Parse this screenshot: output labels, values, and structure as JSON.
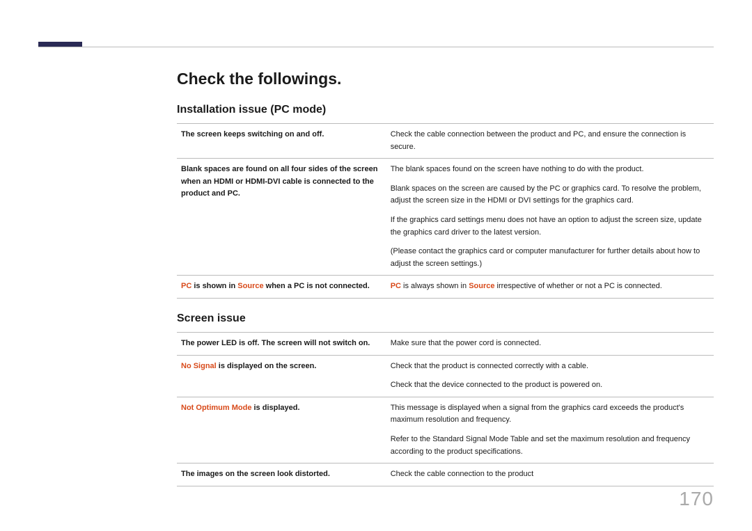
{
  "heading": "Check the followings.",
  "section1": {
    "title": "Installation issue (PC mode)",
    "rows": [
      {
        "problem_parts": [
          {
            "t": "The screen keeps switching on and off.",
            "c": ""
          }
        ],
        "solutions": [
          "Check the cable connection between the product and PC, and ensure the connection is secure."
        ]
      },
      {
        "problem_parts": [
          {
            "t": "Blank spaces are found on all four sides of the screen when an HDMI or HDMI-DVI cable is connected to the product and PC.",
            "c": ""
          }
        ],
        "solutions": [
          "The blank spaces found on the screen have nothing to do with the product.",
          "Blank spaces on the screen are caused by the PC or graphics card. To resolve the problem, adjust the screen size in the HDMI or DVI settings for the graphics card.",
          "If the graphics card settings menu does not have an option to adjust the screen size, update the graphics card driver to the latest version.",
          "(Please contact the graphics card or computer manufacturer for further details about how to adjust the screen settings.)"
        ]
      },
      {
        "problem_parts": [
          {
            "t": "PC",
            "c": "red"
          },
          {
            "t": " is shown in ",
            "c": ""
          },
          {
            "t": "Source",
            "c": "red"
          },
          {
            "t": " when a PC is not connected.",
            "c": ""
          }
        ],
        "solution_parts": [
          {
            "t": "PC",
            "c": "bold red"
          },
          {
            "t": " is always shown in ",
            "c": ""
          },
          {
            "t": "Source",
            "c": "bold red"
          },
          {
            "t": " irrespective of whether or not a PC is connected.",
            "c": ""
          }
        ]
      }
    ]
  },
  "section2": {
    "title": "Screen issue",
    "rows": [
      {
        "problem_parts": [
          {
            "t": "The power LED is off. The screen will not switch on.",
            "c": ""
          }
        ],
        "solutions": [
          "Make sure that the power cord is connected."
        ]
      },
      {
        "problem_parts": [
          {
            "t": "No Signal",
            "c": "red"
          },
          {
            "t": " is displayed on the screen.",
            "c": ""
          }
        ],
        "solutions": [
          "Check that the product is connected correctly with a cable.",
          "Check that the device connected to the product is powered on."
        ]
      },
      {
        "problem_parts": [
          {
            "t": "Not Optimum Mode",
            "c": "red"
          },
          {
            "t": " is displayed.",
            "c": ""
          }
        ],
        "solutions": [
          "This message is displayed when a signal from the graphics card exceeds the product's maximum resolution and frequency.",
          "Refer to the Standard Signal Mode Table and set the maximum resolution and frequency according to the product specifications."
        ]
      },
      {
        "problem_parts": [
          {
            "t": "The images on the screen look distorted.",
            "c": ""
          }
        ],
        "solutions": [
          "Check the cable connection to the product"
        ]
      }
    ]
  },
  "page": "170"
}
